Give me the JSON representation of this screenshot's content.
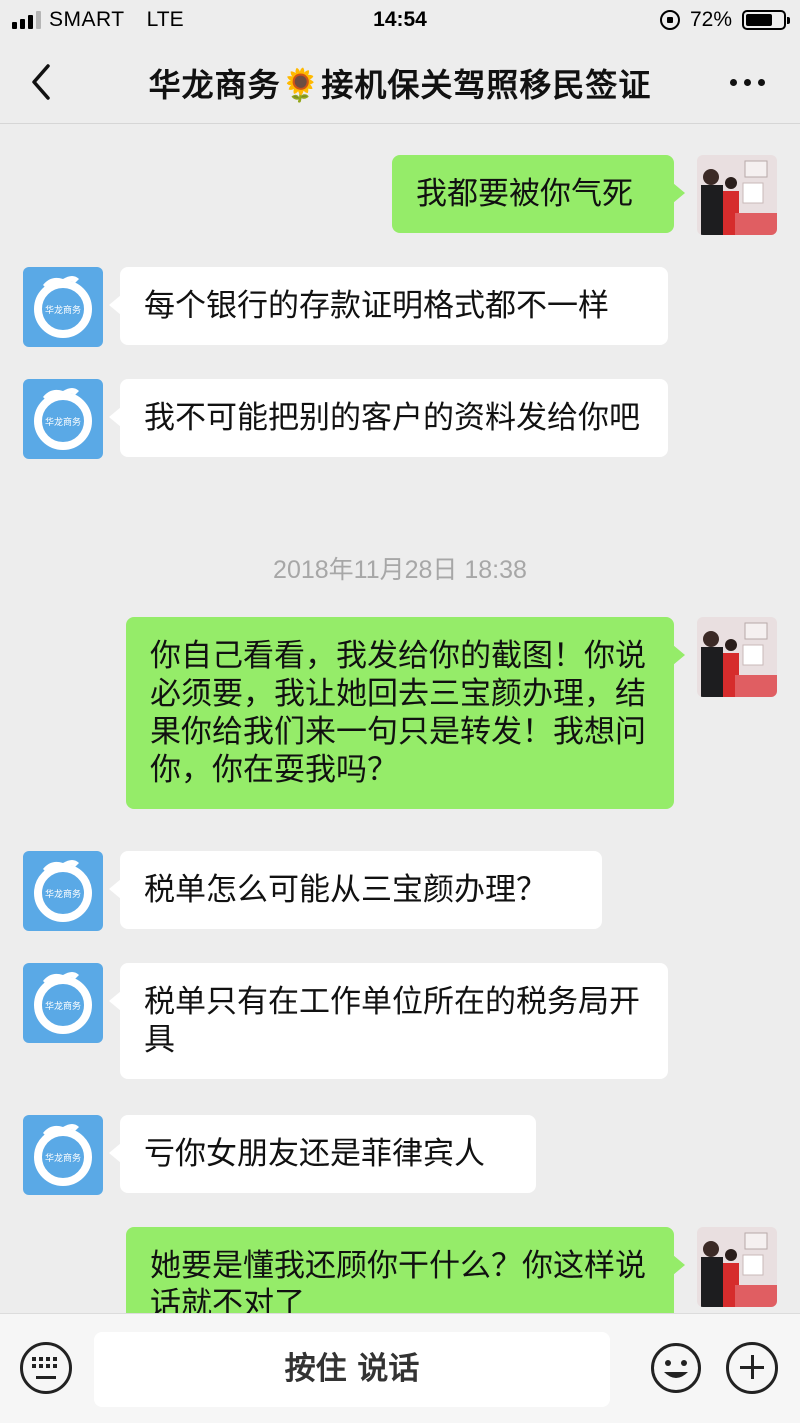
{
  "status_bar": {
    "carrier": "SMART",
    "network": "LTE",
    "time": "14:54",
    "battery": "72%",
    "battery_level": 0.72
  },
  "nav": {
    "title": "华龙商务🌻接机保关驾照移民签证",
    "back_icon": "chevron-left-icon",
    "more_icon": "more-dots-icon"
  },
  "messages": [
    {
      "side": "right",
      "text": "我都要被你气死"
    },
    {
      "side": "left",
      "text": "每个银行的存款证明格式都不一样"
    },
    {
      "side": "left",
      "text": "我不可能把别的客户的资料发给你吧"
    },
    {
      "type": "timestamp",
      "text": "2018年11月28日 18:38"
    },
    {
      "side": "right",
      "text": "你自己看看，我发给你的截图！你说必须要，我让她回去三宝颜办理，结果你给我们来一句只是转发！我想问你，你在耍我吗？"
    },
    {
      "side": "left",
      "text": "税单怎么可能从三宝颜办理？"
    },
    {
      "side": "left",
      "text": "税单只有在工作单位所在的税务局开具"
    },
    {
      "side": "left",
      "text": "亏你女朋友还是菲律宾人"
    },
    {
      "side": "right",
      "text": "她要是懂我还顾你干什么？你这样说话就不对了"
    }
  ],
  "avatars": {
    "self_alt": "user-photo-avatar",
    "contact_alt": "hualong-logo-avatar",
    "contact_logo_text": "华龙商务"
  },
  "input_bar": {
    "hold_to_talk": "按住 说话",
    "left_icon": "keyboard-icon",
    "emoji_icon": "emoji-icon",
    "plus_icon": "plus-icon"
  },
  "colors": {
    "background": "#ededed",
    "self_bubble": "#95ec69",
    "other_bubble": "#ffffff",
    "contact_avatar": "#5aa9e6"
  }
}
